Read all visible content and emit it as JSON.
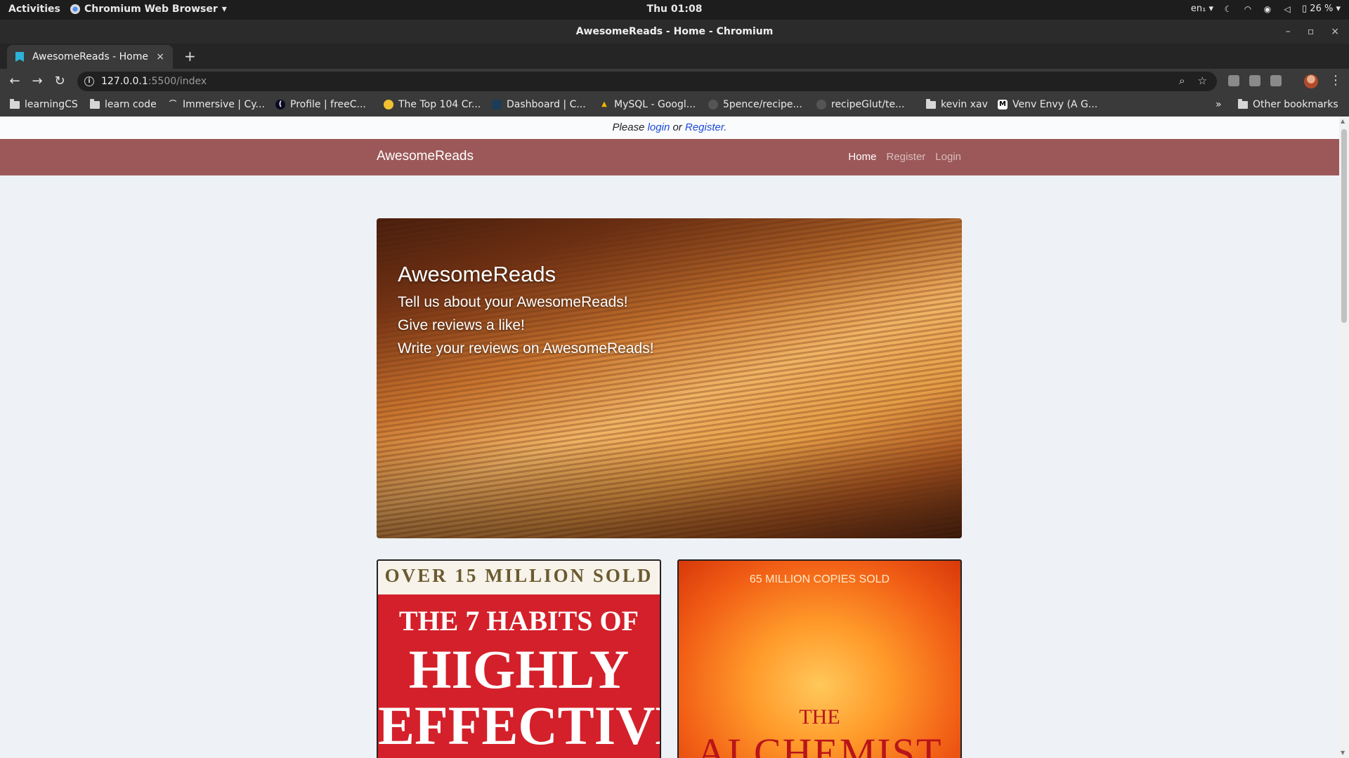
{
  "os": {
    "activities": "Activities",
    "app_menu": "Chromium Web Browser",
    "clock": "Thu 01:08",
    "lang": "en₁",
    "battery": "26 %"
  },
  "window": {
    "title": "AwesomeReads - Home - Chromium"
  },
  "tab": {
    "title": "AwesomeReads - Home",
    "close": "×",
    "new_tab": "+"
  },
  "address": {
    "host": "127.0.0.1",
    "path": ":5500/index"
  },
  "bookmarks": [
    {
      "label": "learningCS",
      "icon": "folder-icon"
    },
    {
      "label": "learn code",
      "icon": "folder-icon"
    },
    {
      "label": "Immersive | Cy...",
      "icon": "site-icon"
    },
    {
      "label": "Profile | freeC...",
      "icon": "site-icon"
    },
    {
      "label": "The Top 104 Cr...",
      "icon": "site-icon"
    },
    {
      "label": "Dashboard | C...",
      "icon": "site-icon"
    },
    {
      "label": "MySQL - Googl...",
      "icon": "drive-icon"
    },
    {
      "label": "5pence/recipe...",
      "icon": "github-icon"
    },
    {
      "label": "recipeGlut/te...",
      "icon": "github-icon"
    },
    {
      "label": "kevin xav",
      "icon": "folder-icon"
    },
    {
      "label": "Venv Envy (A G...",
      "icon": "medium-icon"
    }
  ],
  "bookmarks_overflow": "»",
  "other_bookmarks": "Other bookmarks",
  "flash": {
    "prefix": "Please",
    "login": "login",
    "middle": "or",
    "register": "Register."
  },
  "navbar": {
    "brand": "AwesomeReads",
    "links": [
      "Home",
      "Register",
      "Login"
    ]
  },
  "hero": {
    "title": "AwesomeReads",
    "lines": [
      "Tell us about your AwesomeReads!",
      "Give reviews a like!",
      "Write your reviews on AwesomeReads!"
    ]
  },
  "books": [
    {
      "top": "OVER 15 MILLION SOLD",
      "title_1": "THE 7 HABITS OF",
      "title_2": "HIGHLY",
      "title_3": "EFFECTIVE"
    },
    {
      "top": "65 MILLION COPIES SOLD",
      "title_1": "THE",
      "title_2": "ALCHEMIST"
    }
  ],
  "colors": {
    "navbar": "#9c5858",
    "page_bg": "#eef2f6",
    "link": "#1a4ad6"
  }
}
